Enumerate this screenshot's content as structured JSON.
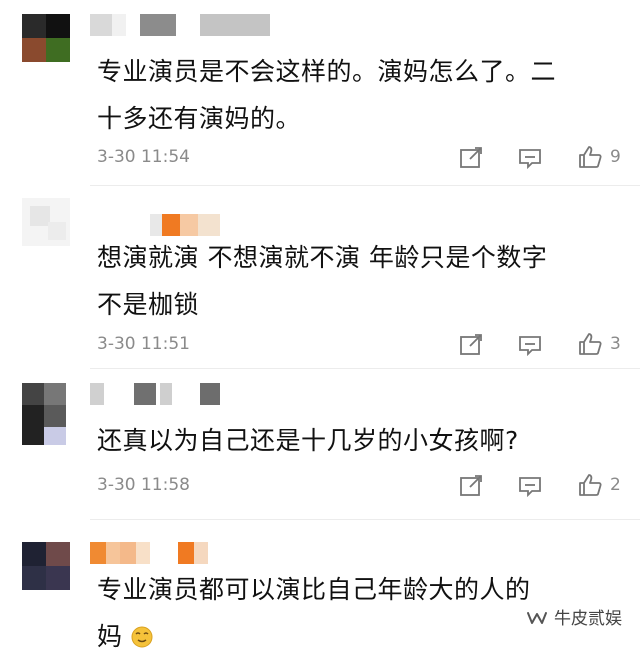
{
  "comments": [
    {
      "text_line1": "专业演员是不会这样的。演妈怎么了。二",
      "text_line2": "十多还有演妈的。",
      "time": "3-30 11:54",
      "likes": "9"
    },
    {
      "text_line1": "想演就演 不想演就不演 年龄只是个数字",
      "text_line2": "不是枷锁",
      "time": "3-30 11:51",
      "likes": "3"
    },
    {
      "text_line1": "还真以为自己还是十几岁的小女孩啊?",
      "time": "3-30 11:58",
      "likes": "2"
    },
    {
      "text_line1": "专业演员都可以演比自己年龄大的人的",
      "text_line2": "妈"
    }
  ],
  "icons": {
    "share": "share-icon",
    "reply": "reply-icon",
    "like": "like-icon",
    "emoji": "hehe-emoji-icon",
    "watermark_logo": "wechat-channel-icon"
  },
  "watermark": {
    "text": "牛皮贰娱"
  },
  "colors": {
    "text": "#111111",
    "meta": "#8a8a8a",
    "emoji": "#f5c23a"
  }
}
